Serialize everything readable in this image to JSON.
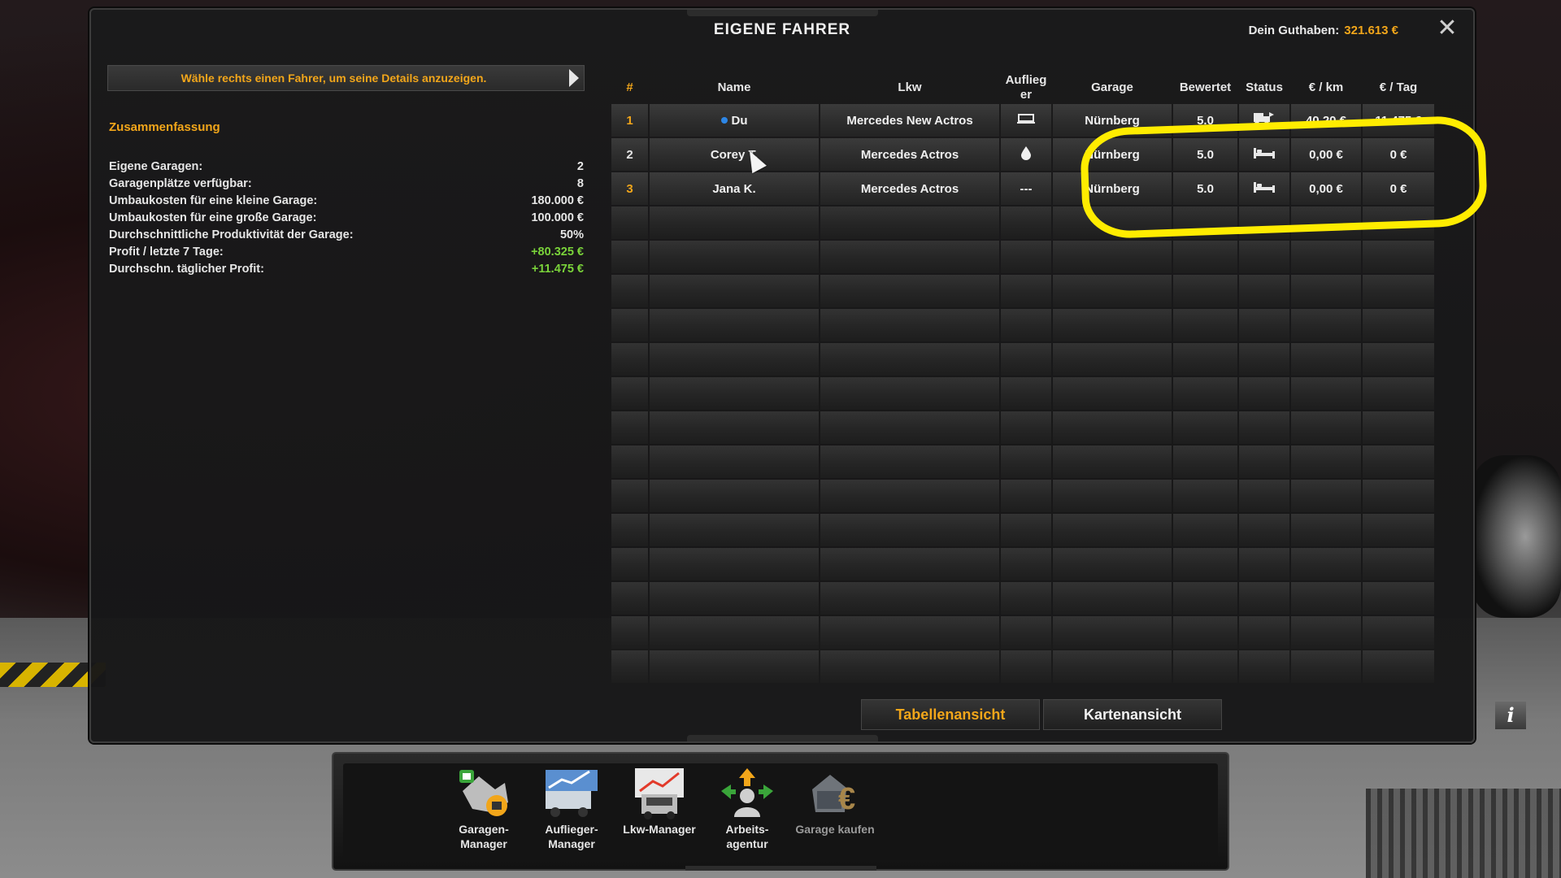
{
  "window": {
    "title": "EIGENE FAHRER",
    "balance_label": "Dein Guthaben:",
    "balance_value": "321.613 €",
    "close_glyph": "✕"
  },
  "left_panel": {
    "hint": "Wähle rechts einen Fahrer, um seine Details anzuzeigen.",
    "summary_title": "Zusammenfassung",
    "summary": [
      {
        "label": "Eigene Garagen:",
        "value": "2"
      },
      {
        "label": "Garagenplätze verfügbar:",
        "value": "8"
      },
      {
        "label": "Umbaukosten für eine kleine Garage:",
        "value": "180.000 €"
      },
      {
        "label": "Umbaukosten für eine große Garage:",
        "value": "100.000 €"
      },
      {
        "label": "Durchschnittliche Produktivität der Garage:",
        "value": "50%"
      },
      {
        "label": "Profit / letzte 7 Tage:",
        "value": "+80.325 €"
      },
      {
        "label": "Durchschn. täglicher Profit:",
        "value": "+11.475 €"
      }
    ]
  },
  "table": {
    "headers": [
      "#",
      "Name",
      "Lkw",
      "Auflieg er",
      "Garage",
      "Bewertet",
      "Status",
      "€ / km",
      "€ / Tag"
    ],
    "rows": [
      {
        "num": "1",
        "name": "Du",
        "truck": "Mercedes New Actros",
        "trailer": "trailer-icon",
        "garage": "Nürnberg",
        "rating": "5.0",
        "status": "driving-icon",
        "per_km": "40,20 €",
        "per_day": "11.475 €"
      },
      {
        "num": "2",
        "name": "Corey T.",
        "truck": "Mercedes Actros",
        "trailer": "fuel-drop-icon",
        "garage": "Nürnberg",
        "rating": "5.0",
        "status": "bed-icon",
        "per_km": "0,00 €",
        "per_day": "0 €"
      },
      {
        "num": "3",
        "name": "Jana K.",
        "truck": "Mercedes Actros",
        "trailer": "---",
        "garage": "Nürnberg",
        "rating": "5.0",
        "status": "bed-icon",
        "per_km": "0,00 €",
        "per_day": "0 €"
      }
    ],
    "empty_rows": 14
  },
  "views": {
    "table_view": "Tabellenansicht",
    "map_view": "Kartenansicht",
    "info": "i"
  },
  "dock": [
    {
      "label1": "Garagen-",
      "label2": "Manager",
      "icon": "garage-manager-icon",
      "enabled": true
    },
    {
      "label1": "Auflieger-",
      "label2": "Manager",
      "icon": "trailer-manager-icon",
      "enabled": true
    },
    {
      "label1": "Lkw-Manager",
      "label2": "",
      "icon": "truck-manager-icon",
      "enabled": true
    },
    {
      "label1": "Arbeits-",
      "label2": "agentur",
      "icon": "employment-agency-icon",
      "enabled": true
    },
    {
      "label1": "Garage kaufen",
      "label2": "",
      "icon": "buy-garage-icon",
      "enabled": false
    }
  ],
  "colors": {
    "accent": "#f2a61a",
    "profit": "#7ad33a",
    "highlight": "#ffec00",
    "player_dot": "#2d86e6"
  }
}
